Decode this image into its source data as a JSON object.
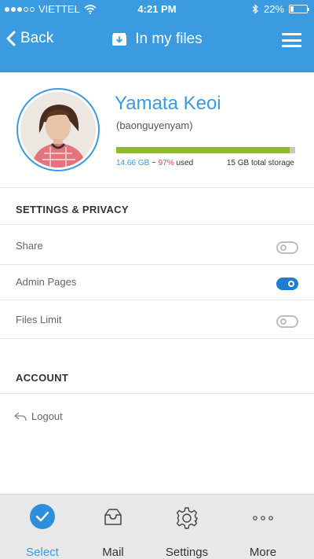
{
  "status_bar": {
    "carrier": "VIETTEL",
    "time": "4:21 PM",
    "battery_percent": "22%",
    "battery_level": 0.22,
    "signal_bars_filled": 3,
    "signal_bars_total": 5,
    "icons": [
      "wifi-icon",
      "bluetooth-icon",
      "battery-icon"
    ]
  },
  "nav": {
    "back_label": "Back",
    "title": "In my files",
    "title_icon": "inbox-download-icon",
    "menu_icon": "hamburger-menu-icon"
  },
  "profile": {
    "name": "Yamata Keoi",
    "username": "(baonguyenyam)",
    "storage_used": "14.66 GB",
    "storage_sep": " ~ ",
    "storage_percent": "97%",
    "storage_used_suffix": " used",
    "storage_total": "15 GB total storage",
    "storage_fraction": 0.97,
    "colors": {
      "used_bar": "#8fba2c",
      "bar_bg": "#c8c8c8",
      "accent": "#3a9be0",
      "percent": "#e2474d"
    }
  },
  "settings": {
    "title": "SETTINGS & PRIVACY",
    "items": [
      {
        "label": "Share",
        "on": false
      },
      {
        "label": "Admin Pages",
        "on": true
      },
      {
        "label": "Files Limit",
        "on": false
      }
    ]
  },
  "account": {
    "title": "ACCOUNT",
    "logout_label": "Logout",
    "logout_icon": "reply-arrow-icon"
  },
  "tabbar": {
    "tabs": [
      {
        "label": "Select",
        "icon": "check-circle-icon",
        "active": true
      },
      {
        "label": "Mail",
        "icon": "inbox-tray-icon",
        "active": false
      },
      {
        "label": "Settings",
        "icon": "gear-icon",
        "active": false
      },
      {
        "label": "More",
        "icon": "more-dots-icon",
        "active": false
      }
    ]
  }
}
